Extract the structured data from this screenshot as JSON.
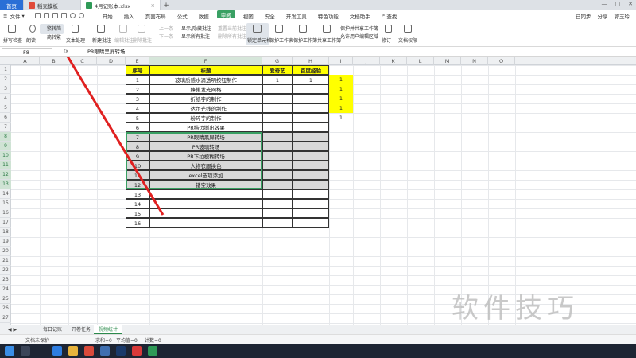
{
  "tabs": {
    "home": "首页",
    "t1": "稻壳模板",
    "active": "4月记账本.xlsx"
  },
  "menubar": {
    "file": "文件",
    "items": [
      "开始",
      "插入",
      "页面布局",
      "公式",
      "数据",
      "审阅",
      "视图",
      "安全",
      "开发工具",
      "特色功能",
      "文档助手"
    ],
    "active": "审阅",
    "search": "查找",
    "sync": "已同步",
    "share": "分享",
    "user": "郭玉玲"
  },
  "ribbon": {
    "spell": "拼写检查",
    "read": "朗读",
    "trad": "繁转简",
    "simp": "简转繁",
    "textconv": "文本处理",
    "new_comment": "新建批注",
    "edit_comment": "编辑批注",
    "del_comment": "删除批注",
    "prev": "上一条",
    "next": "下一条",
    "show_hide": "显示/隐藏批注",
    "show_all": "显示所有批注",
    "reset": "重置当前批注",
    "delete_all": "删除所有批注",
    "lock": "锁定单元格",
    "protect_sheet": "保护工作表",
    "protect_book": "保护工作簿",
    "share_book": "共享工作簿",
    "protect_share": "保护并共享工作簿",
    "allow_edit": "允许用户编辑区域",
    "revise": "修订",
    "compare": "文档权限"
  },
  "formula": {
    "cell": "F8",
    "fx": "fx",
    "value": "PR眼睛黑屏转场"
  },
  "columns": [
    "A",
    "B",
    "C",
    "D",
    "E",
    "F",
    "G",
    "H",
    "I",
    "J",
    "K",
    "L",
    "M",
    "N",
    "O"
  ],
  "rows": [
    "1",
    "2",
    "3",
    "4",
    "5",
    "6",
    "7",
    "8",
    "9",
    "10",
    "11",
    "12",
    "13",
    "14",
    "15",
    "16",
    "17",
    "18",
    "19",
    "20",
    "21",
    "22",
    "23",
    "24",
    "25",
    "26",
    "27"
  ],
  "table": {
    "headers": [
      "序号",
      "标题",
      "爱奇艺",
      "百度经验"
    ],
    "rows": [
      {
        "no": "1",
        "title": "玻璃质感水滴透明按钮制作",
        "a": "1",
        "b": "1",
        "c": "1"
      },
      {
        "no": "2",
        "title": "蜂巢发光网格",
        "a": "",
        "b": "",
        "c": "1"
      },
      {
        "no": "3",
        "title": "折纸字的制作",
        "a": "",
        "b": "",
        "c": "1"
      },
      {
        "no": "4",
        "title": "丁达尔光线的制作",
        "a": "",
        "b": "",
        "c": "1"
      },
      {
        "no": "5",
        "title": "粉碎字的制作",
        "a": "",
        "b": "",
        "c": "1"
      },
      {
        "no": "6",
        "title": "PR描边撕出效果",
        "a": "",
        "b": "",
        "c": ""
      },
      {
        "no": "7",
        "title": "PR眼睛黑屏转场",
        "a": "",
        "b": "",
        "c": ""
      },
      {
        "no": "8",
        "title": "PR玻璃转场",
        "a": "",
        "b": "",
        "c": ""
      },
      {
        "no": "9",
        "title": "PR下拉模糊转场",
        "a": "",
        "b": "",
        "c": ""
      },
      {
        "no": "10",
        "title": "人物衣服换色",
        "a": "",
        "b": "",
        "c": ""
      },
      {
        "no": "11",
        "title": "excel选项添加",
        "a": "",
        "b": "",
        "c": ""
      },
      {
        "no": "12",
        "title": "镂空效果",
        "a": "",
        "b": "",
        "c": ""
      },
      {
        "no": "13",
        "title": "",
        "a": "",
        "b": "",
        "c": ""
      },
      {
        "no": "14",
        "title": "",
        "a": "",
        "b": "",
        "c": ""
      },
      {
        "no": "15",
        "title": "",
        "a": "",
        "b": "",
        "c": ""
      },
      {
        "no": "16",
        "title": "",
        "a": "",
        "b": "",
        "c": ""
      }
    ]
  },
  "sheets": [
    "每日记账",
    "开卷任务",
    "视频统计"
  ],
  "active_sheet": "视频统计",
  "status": {
    "protect": "文档未保护",
    "sum": "求和=0",
    "avg": "平均值=0",
    "count": "计数=0"
  },
  "watermark": "软件技巧",
  "colors": {
    "yellow": "#ffff00",
    "green": "#39a063",
    "select": "#d9d9d9",
    "arrow": "#e02020"
  }
}
